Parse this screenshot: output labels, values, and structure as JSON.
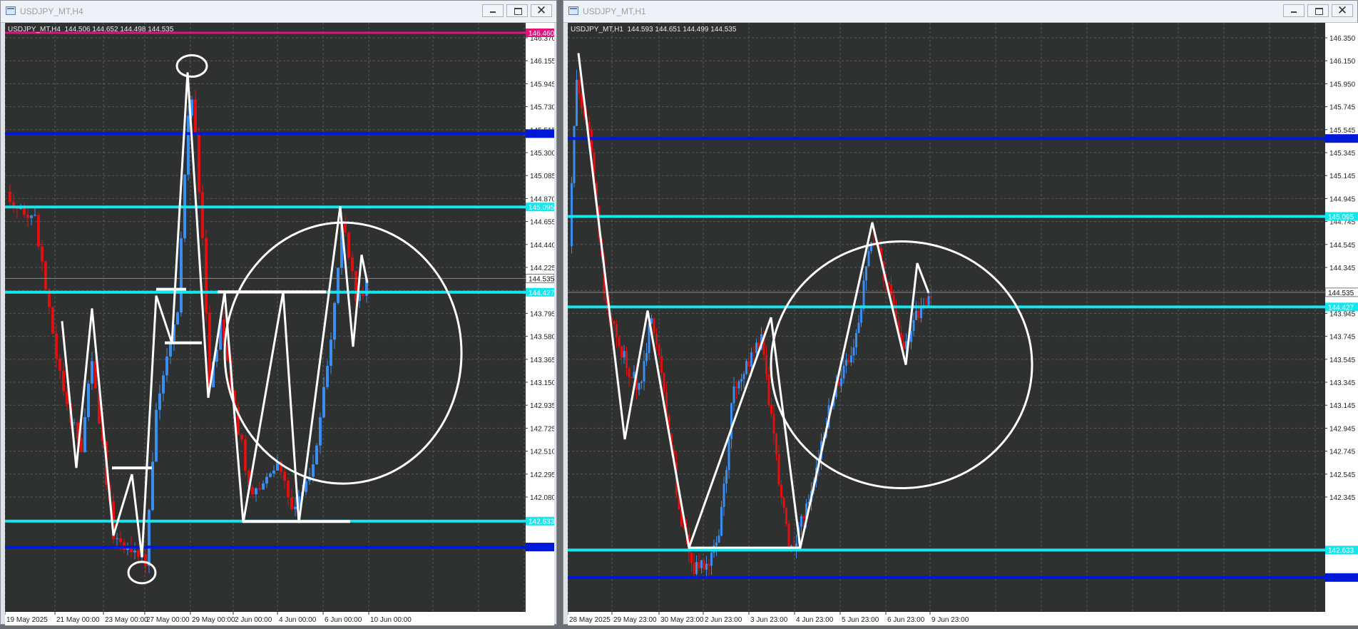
{
  "windows": [
    {
      "title": "USDJPY_MT,H4",
      "symbol_line": "USDJPY_MT,H4  144.506 144.652 144.498 144.535",
      "current_price": "144.535",
      "price_range": [
        142.0,
        146.46
      ],
      "price_labels": [
        "146.370",
        "146.155",
        "145.945",
        "145.730",
        "145.515",
        "145.300",
        "145.085",
        "144.870",
        "144.655",
        "144.440",
        "144.225",
        "144.010",
        "143.795",
        "143.580",
        "143.365",
        "143.150",
        "142.935",
        "142.725",
        "142.510",
        "142.295",
        "142.080"
      ],
      "time_labels": [
        "19 May 2025",
        "21 May 00:00",
        "23 May 00:00",
        "27 May 00:00",
        "29 May 00:00",
        "2 Jun 00:00",
        "4 Jun 00:00",
        "6 Jun 00:00",
        "10 Jun 00:00"
      ],
      "hlines": [
        {
          "price": 146.46,
          "color": "#e0147a",
          "label": "146.460",
          "style": "magenta"
        },
        {
          "price": 145.67,
          "color": "#0018d8",
          "label": "145.670",
          "style": "blue"
        },
        {
          "price": 145.095,
          "color": "#14e6ee",
          "label": "145.095",
          "style": "cyan"
        },
        {
          "price": 144.427,
          "color": "#14e6ee",
          "label": "144.427",
          "style": "cyan"
        },
        {
          "price": 142.633,
          "color": "#14e6ee",
          "label": "142.633",
          "style": "cyan"
        },
        {
          "price": 142.43,
          "color": "#0018d8",
          "label": "142.430",
          "style": "blue"
        }
      ],
      "colors": {
        "bg": "#2f3030",
        "grid": "#5a5a5a",
        "bull": "#3a8ef0",
        "bear": "#e01010",
        "drawing": "#ffffff"
      }
    },
    {
      "title": "USDJPY_MT,H1",
      "symbol_line": "USDJPY_MT,H1  144.593 144.651 144.499 144.535",
      "current_price": "144.535",
      "price_range": [
        142.25,
        146.45
      ],
      "price_labels": [
        "146.350",
        "146.150",
        "145.950",
        "145.745",
        "145.545",
        "145.345",
        "145.145",
        "144.945",
        "144.745",
        "144.545",
        "144.345",
        "144.145",
        "143.945",
        "143.745",
        "143.545",
        "143.345",
        "143.145",
        "142.945",
        "142.745",
        "142.545",
        "142.345"
      ],
      "time_labels": [
        "28 May 2025",
        "29 May 23:00",
        "30 May 23:00",
        "2 Jun 23:00",
        "3 Jun 23:00",
        "4 Jun 23:00",
        "5 Jun 23:00",
        "6 Jun 23:00",
        "9 Jun 23:00"
      ],
      "hlines": [
        {
          "price": 145.67,
          "color": "#0018d8",
          "label": "145.670",
          "style": "blue"
        },
        {
          "price": 145.095,
          "color": "#14e6ee",
          "label": "145.095",
          "style": "cyan"
        },
        {
          "price": 144.427,
          "color": "#14e6ee",
          "label": "144.427",
          "style": "cyan"
        },
        {
          "price": 142.633,
          "color": "#14e6ee",
          "label": "142.633",
          "style": "cyan"
        },
        {
          "price": 142.43,
          "color": "#0018d8",
          "label": "142.430",
          "style": "blue"
        }
      ],
      "colors": {
        "bg": "#2f3030",
        "grid": "#5a5a5a",
        "bull": "#3a8ef0",
        "bear": "#e01010",
        "drawing": "#ffffff"
      }
    }
  ]
}
